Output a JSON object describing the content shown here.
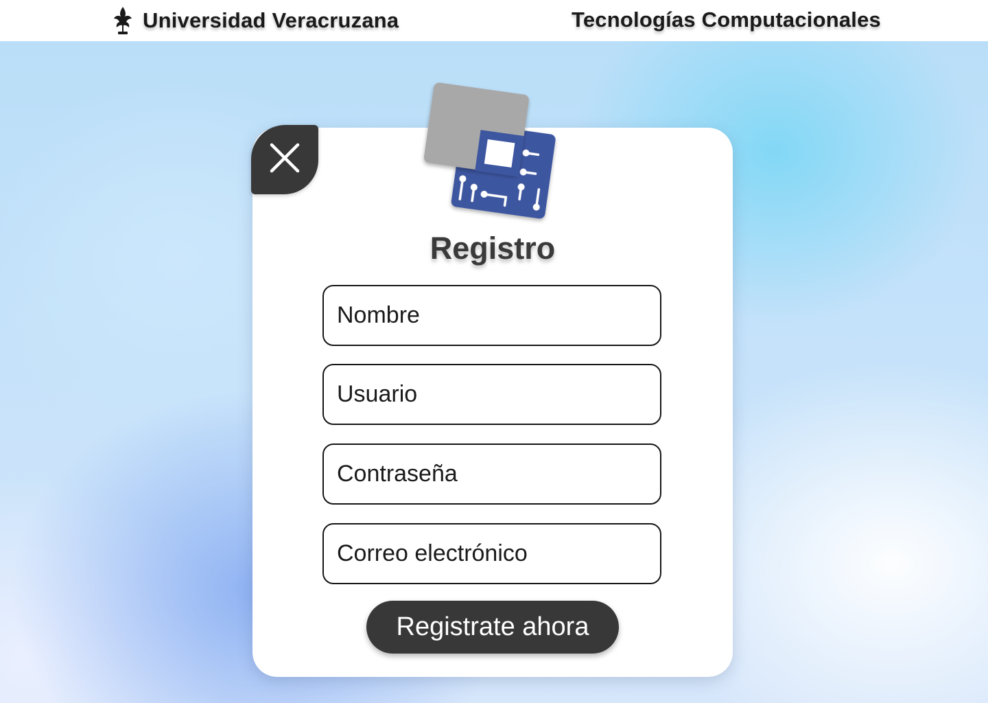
{
  "header": {
    "brand_name": "Universidad Veracruzana",
    "brand_logo_icon": "uv-fleur-logo-icon",
    "department": "Tecnologías Computacionales"
  },
  "modal": {
    "close_icon": "close-icon",
    "logo_icon": "circuit-chip-logo-icon",
    "title": "Registro",
    "fields": {
      "nombre_placeholder": "Nombre",
      "usuario_placeholder": "Usuario",
      "password_placeholder": "Contraseña",
      "email_placeholder": "Correo electrónico"
    },
    "submit_label": "Registrate ahora"
  },
  "colors": {
    "dark_button": "#383838",
    "logo_blue": "#3d56a0",
    "logo_gray": "#a8a8a8",
    "card_background": "#ffffff"
  }
}
